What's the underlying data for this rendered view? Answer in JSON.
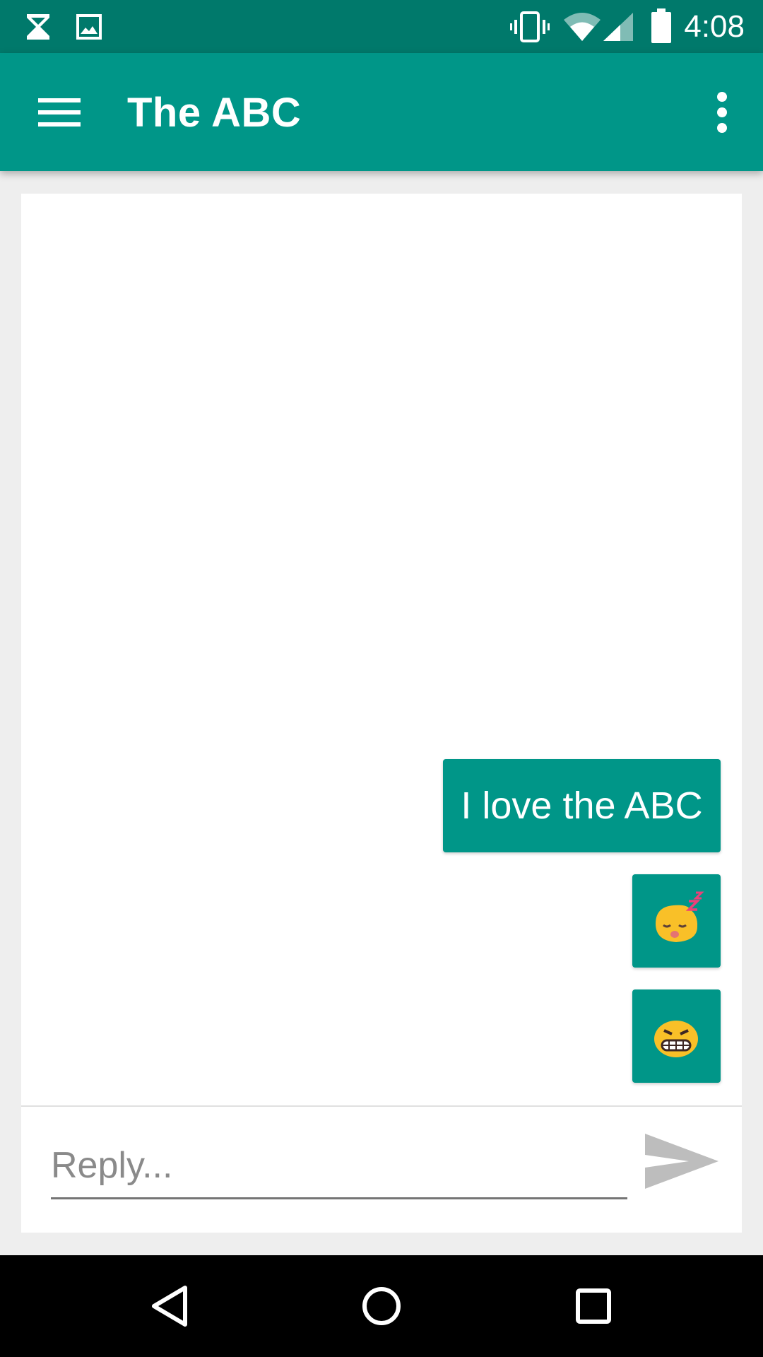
{
  "status_bar": {
    "time": "4:08",
    "left_icons": [
      "hourglass-icon",
      "image-icon"
    ],
    "right_icons": [
      "vibrate-icon",
      "wifi-icon",
      "cell-signal-icon",
      "battery-icon"
    ]
  },
  "app_bar": {
    "title": "The ABC",
    "menu_icon": "hamburger-menu-icon",
    "overflow_icon": "more-vert-icon",
    "color": "#009688"
  },
  "messages": [
    {
      "type": "text",
      "text": "I love the ABC"
    },
    {
      "type": "emoji",
      "emoji": "sleeping-face"
    },
    {
      "type": "emoji",
      "emoji": "grimacing-angry-face"
    }
  ],
  "composer": {
    "placeholder": "Reply...",
    "value": "",
    "send_icon": "send-icon"
  },
  "nav_bar": {
    "buttons": [
      "back-icon",
      "home-icon",
      "recents-icon"
    ]
  },
  "colors": {
    "status_bar": "#00796b",
    "accent": "#009688",
    "background": "#eeeeee"
  }
}
